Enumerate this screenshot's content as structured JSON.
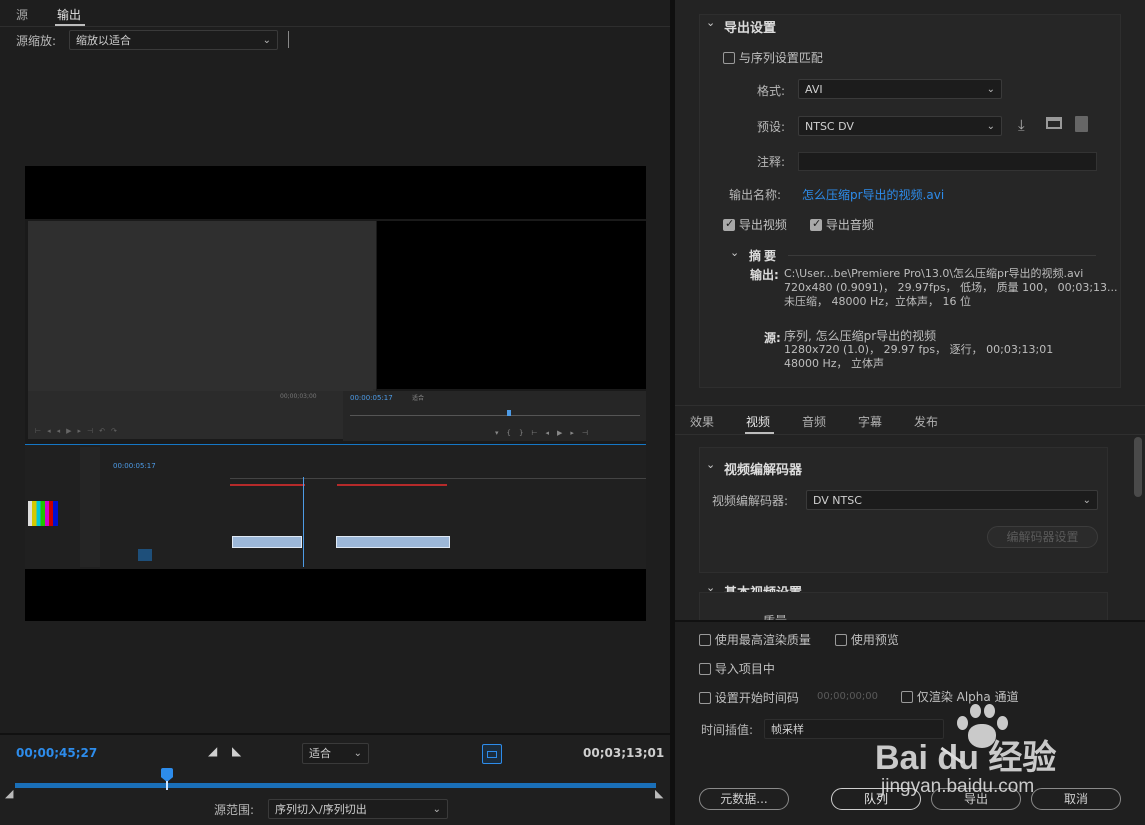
{
  "left": {
    "tabs": [
      "源",
      "输出"
    ],
    "source_scale_label": "源缩放:",
    "source_scale_value": "缩放以适合",
    "timecode_current": "00;00;45;27",
    "fit_value": "适合",
    "timecode_total": "00;03;13;01",
    "source_range_label": "源范围:",
    "source_range_value": "序列切入/序列切出",
    "playhead_fraction": 0.237
  },
  "export_settings": {
    "section_title": "导出设置",
    "match_sequence_label": "与序列设置匹配",
    "match_sequence_checked": false,
    "format_label": "格式:",
    "format_value": "AVI",
    "preset_label": "预设:",
    "preset_value": "NTSC DV",
    "comment_label": "注释:",
    "comment_value": "",
    "output_name_label": "输出名称:",
    "output_name_value": "怎么压缩pr导出的视频.avi",
    "export_video_label": "导出视频",
    "export_video_checked": true,
    "export_audio_label": "导出音频",
    "export_audio_checked": true,
    "summary_title": "摘要",
    "summary_output_label": "输出:",
    "summary_output_lines": [
      "C:\\User...be\\Premiere  Pro\\13.0\\怎么压缩pr导出的视频.avi",
      "720x480  (0.9091)， 29.97fps， 低场， 质量 100， 00;03;13...",
      "未压缩， 48000  Hz，立体声， 16 位"
    ],
    "summary_source_label": "源:",
    "summary_source_lines": [
      "序列, 怎么压缩pr导出的视频",
      "1280x720  (1.0)， 29.97  fps， 逐行， 00;03;13;01",
      "48000  Hz， 立体声"
    ]
  },
  "tabs": [
    "效果",
    "视频",
    "音频",
    "字幕",
    "发布"
  ],
  "active_tab": "视频",
  "video_codec": {
    "section_title": "视频编解码器",
    "codec_label": "视频编解码器:",
    "codec_value": "DV NTSC",
    "codec_settings_button": "编解码器设置"
  },
  "basic_video": {
    "section_title": "基本视频设置",
    "quality_label": "质量"
  },
  "options": {
    "max_render_quality": "使用最高渲染质量",
    "use_previews": "使用预览",
    "import_into_project": "导入项目中",
    "set_start_timecode": "设置开始时间码",
    "start_timecode_value": "00;00;00;00",
    "render_alpha_only": "仅渲染 Alpha 通道",
    "time_interpolation_label": "时间插值:",
    "time_interpolation_value": "帧采样"
  },
  "buttons": {
    "metadata": "元数据...",
    "queue": "队列",
    "export": "导出",
    "cancel": "取消"
  },
  "watermark": {
    "brand": "Bai du 经验",
    "url": "jingyan.baidu.com"
  },
  "preview_ui": {
    "monitor_timecode": "00:00:05:17",
    "monitor_fit": "适合",
    "timeline_timecode": "00:00:05:17",
    "left_timecode": "00;00;03;00"
  },
  "colors": {
    "accent_blue": "#2d8ceb",
    "panel_bg": "#232323",
    "app_bg": "#1d1d1d"
  }
}
